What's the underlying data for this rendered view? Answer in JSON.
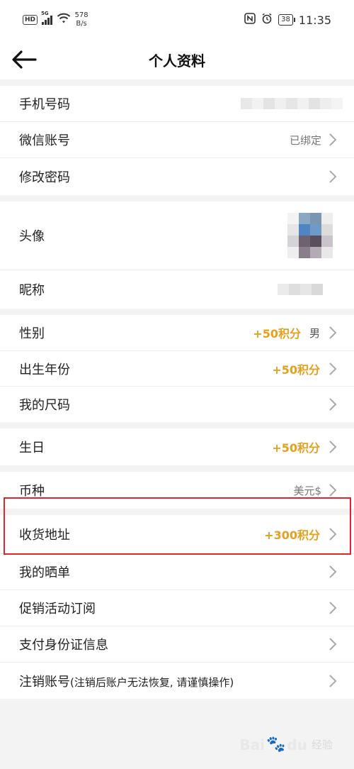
{
  "status_bar": {
    "hd": "HD",
    "network": "5G",
    "speed_value": "578",
    "speed_unit": "B/s",
    "battery": "38",
    "time": "11:35"
  },
  "header": {
    "title": "个人资料",
    "back_icon": "arrow-left-icon"
  },
  "groups": [
    {
      "rows": [
        {
          "label": "手机号码",
          "value": "",
          "masked": "phone"
        },
        {
          "label": "微信账号",
          "value": "已绑定",
          "chevron": true
        },
        {
          "label": "修改密码",
          "chevron": true
        }
      ]
    },
    {
      "rows": [
        {
          "label": "头像",
          "masked": "avatar"
        },
        {
          "label": "昵称",
          "masked": "nickname"
        }
      ]
    },
    {
      "rows": [
        {
          "label": "性别",
          "points": "+50积分",
          "value": "男",
          "chevron": true
        },
        {
          "label": "出生年份",
          "points": "+50积分",
          "chevron": true
        },
        {
          "label": "我的尺码",
          "chevron": true
        }
      ]
    },
    {
      "rows": [
        {
          "label": "生日",
          "points": "+50积分",
          "chevron": true
        }
      ]
    },
    {
      "rows": [
        {
          "label": "币种",
          "value": "美元$",
          "chevron": true
        }
      ]
    },
    {
      "rows": [
        {
          "label": "收货地址",
          "points": "+300积分",
          "chevron": true
        },
        {
          "label": "我的晒单",
          "chevron": true
        },
        {
          "label": "促销活动订阅",
          "chevron": true
        },
        {
          "label": "支付身份证信息",
          "chevron": true
        },
        {
          "label": "注销账号",
          "label_note": "(注销后账户无法恢复, 请谨慎操作)",
          "chevron": true
        }
      ]
    }
  ],
  "watermark": {
    "brand": "Bai",
    "brand2": "du",
    "suffix": "经验"
  },
  "colors": {
    "points": "#e6a020",
    "highlight": "#e0262d",
    "background": "#f3f3f3"
  }
}
